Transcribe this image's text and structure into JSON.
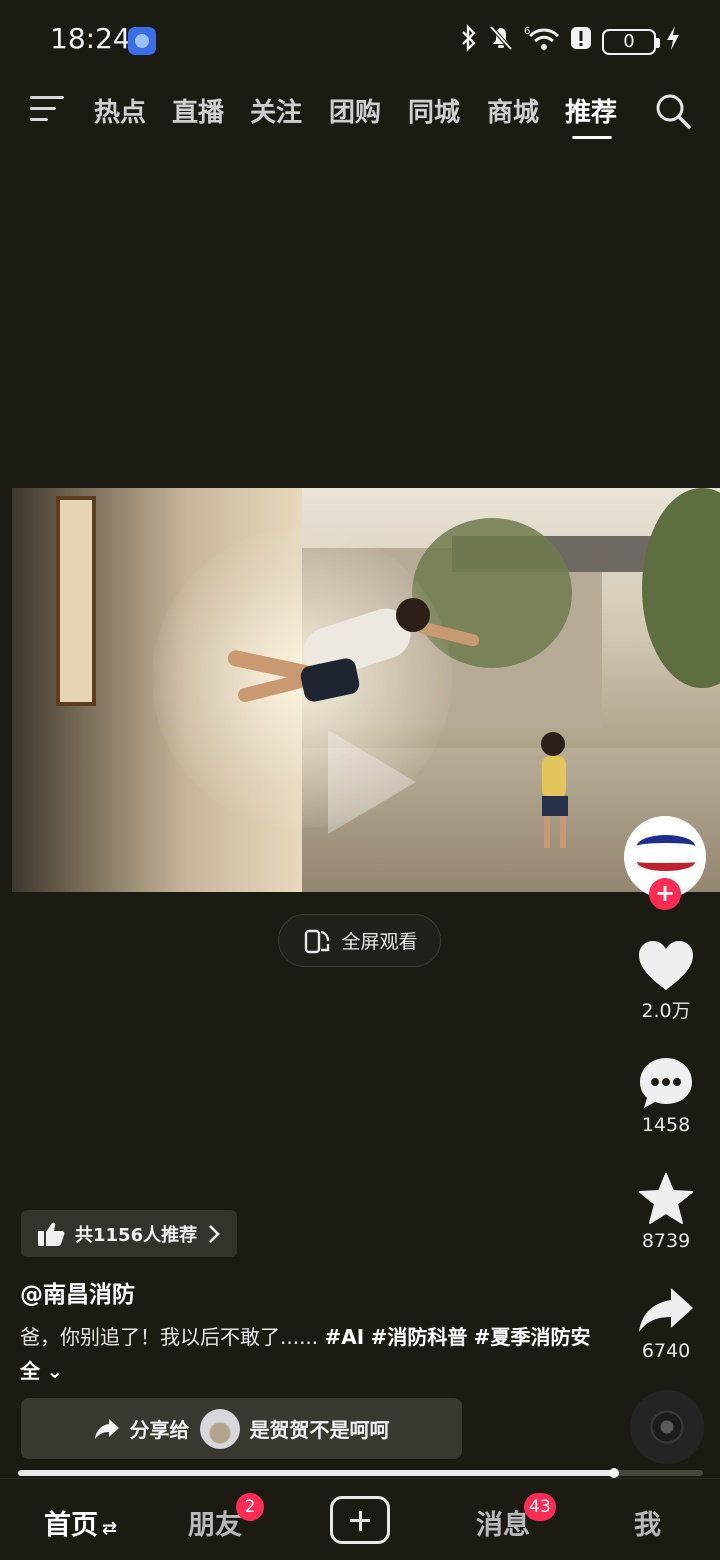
{
  "status_bar": {
    "time": "18:24",
    "battery": "0",
    "icons": [
      "bluetooth-icon",
      "mute-bell-icon",
      "wifi-6-icon",
      "alert-icon",
      "battery-icon",
      "charging-icon"
    ]
  },
  "top_nav": {
    "tabs": [
      {
        "label": "热点"
      },
      {
        "label": "直播"
      },
      {
        "label": "关注"
      },
      {
        "label": "团购"
      },
      {
        "label": "同城"
      },
      {
        "label": "商城"
      },
      {
        "label": "推荐"
      }
    ],
    "active_tab": "推荐"
  },
  "video": {
    "fullscreen_label": "全屏观看",
    "progress_fraction": 0.87
  },
  "right_rail": {
    "likes": "2.0万",
    "comments": "1458",
    "favorites": "8739",
    "shares": "6740",
    "follow_symbol": "+"
  },
  "info": {
    "recommend": "共1156人推荐",
    "author": "@南昌消防",
    "caption_text": "爸，你别追了！我以后不敢了......",
    "hashtags": [
      "#AI",
      "#消防科普",
      "#夏季消防安全"
    ],
    "share_label": "分享给",
    "share_target": "是贺贺不是呵呵"
  },
  "bottom_nav": {
    "home": "首页",
    "friends": "朋友",
    "friends_badge": "2",
    "messages": "消息",
    "messages_badge": "43",
    "me": "我"
  },
  "colors": {
    "background": "#1b1a13",
    "badge": "#fe2c55",
    "follow": "#fe2c55"
  }
}
